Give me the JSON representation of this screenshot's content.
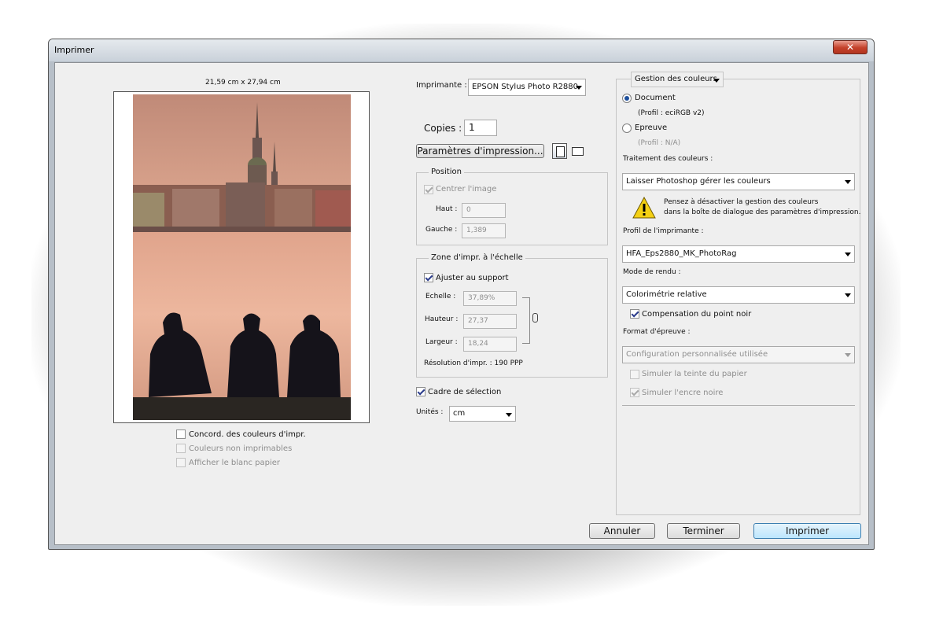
{
  "window": {
    "title": "Imprimer",
    "close_glyph": "✕"
  },
  "preview": {
    "paper_size": "21,59 cm x 27,94 cm",
    "checks": {
      "concord": "Concord. des couleurs d'impr.",
      "non_printable": "Couleurs non imprimables",
      "paper_white": "Afficher le blanc papier"
    }
  },
  "middle": {
    "printer_label": "Imprimante :",
    "printer_value": "EPSON Stylus Photo R2880",
    "copies_label": "Copies :",
    "copies_value": "1",
    "print_settings_button": "Paramètres d'impression...",
    "position": {
      "title": "Position",
      "center_image": "Centrer l'image",
      "top_label": "Haut :",
      "top_value": "0",
      "left_label": "Gauche :",
      "left_value": "1,389"
    },
    "scale": {
      "title": "Zone d'impr. à l'échelle",
      "fit_media": "Ajuster au support",
      "scale_label": "Echelle :",
      "scale_value": "37,89%",
      "height_label": "Hauteur :",
      "height_value": "27,37",
      "width_label": "Largeur :",
      "width_value": "18,24",
      "resolution": "Résolution d'impr. : 190 PPP"
    },
    "bounding_box": "Cadre de sélection",
    "units_label": "Unités :",
    "units_value": "cm"
  },
  "color": {
    "section_select": "Gestion des couleurs",
    "document_label": "Document",
    "document_profile": "(Profil : eciRGB v2)",
    "proof_label": "Epreuve",
    "proof_profile": "(Profil : N/A)",
    "handling_label": "Traitement des couleurs :",
    "handling_value": "Laisser Photoshop gérer les couleurs",
    "warning_line1": "Pensez à désactiver la gestion des couleurs",
    "warning_line2": "dans la boîte de dialogue des paramètres d'impression.",
    "printer_profile_label": "Profil de l'imprimante :",
    "printer_profile_value": "HFA_Eps2880_MK_PhotoRag",
    "rendering_label": "Mode de rendu :",
    "rendering_value": "Colorimétrie relative",
    "black_point": "Compensation du point noir",
    "proof_format_label": "Format d'épreuve :",
    "proof_format_value": "Configuration personnalisée utilisée",
    "simulate_paper": "Simuler la teinte du papier",
    "simulate_ink": "Simuler l'encre noire"
  },
  "buttons": {
    "cancel": "Annuler",
    "done": "Terminer",
    "print": "Imprimer"
  },
  "colors": {
    "accent": "#3c7fb1",
    "close": "#c4412a",
    "dialog_bg": "#efefef"
  }
}
